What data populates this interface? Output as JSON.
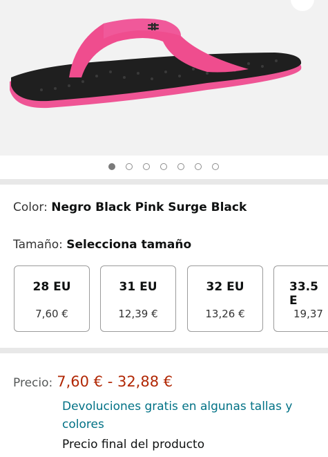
{
  "product_image": {
    "alt": "flip-flop-sandal-image",
    "brand_logo": "under-armour-logo",
    "colors": {
      "strap": "#ef4d8e",
      "sole_top": "#222222",
      "sole_bottom": "#f0599a",
      "background": "#f2f2f2"
    },
    "carousel": {
      "total": 7,
      "active_index": 0
    }
  },
  "color": {
    "label": "Color: ",
    "value": "Negro Black Pink Surge Black"
  },
  "size": {
    "label": "Tamaño: ",
    "value": "Selecciona tamaño",
    "options": [
      {
        "size": "28 EU",
        "price": "7,60 €"
      },
      {
        "size": "31 EU",
        "price": "12,39 €"
      },
      {
        "size": "32 EU",
        "price": "13,26 €"
      },
      {
        "size": "33.5 E",
        "price": "19,37"
      }
    ]
  },
  "price": {
    "label": "Precio:",
    "value": "7,60 € - 32,88 €",
    "returns_link": "Devoluciones gratis en algunas tallas y colores",
    "final_note": "Precio final del producto",
    "colors": {
      "price": "#b12704",
      "link": "#007185"
    }
  }
}
